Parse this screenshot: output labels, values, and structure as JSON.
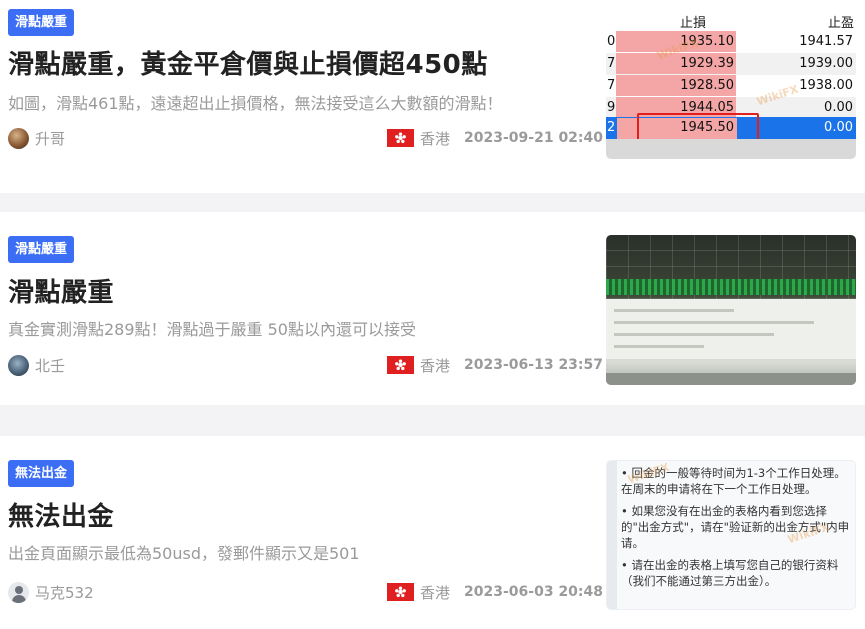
{
  "articles": [
    {
      "tag": "滑點嚴重",
      "title": "滑點嚴重，黃金平倉價與止損價超450點",
      "summary": "如圖，滑點461點，遠遠超出止損價格，無法接受這么大數額的滑點！",
      "author": "升哥",
      "region": "香港",
      "time": "2023-09-21 02:40",
      "thumb": {
        "headers": [
          "止損",
          "止盈"
        ],
        "rows": [
          {
            "idx": "0",
            "sl": "1935.10",
            "tp": "1941.57"
          },
          {
            "idx": "7",
            "sl": "1929.39",
            "tp": "1939.00"
          },
          {
            "idx": "7",
            "sl": "1928.50",
            "tp": "1938.00"
          },
          {
            "idx": "9",
            "sl": "1944.05",
            "tp": "0.00"
          },
          {
            "idx": "2",
            "sl": "1945.50",
            "tp": "0.00"
          }
        ]
      }
    },
    {
      "tag": "滑點嚴重",
      "title": "滑點嚴重",
      "summary": "真金實測滑點289點！滑點過于嚴重 50點以內還可以接受",
      "author": "北壬",
      "region": "香港",
      "time": "2023-06-13 23:57"
    },
    {
      "tag": "無法出金",
      "title": "無法出金",
      "summary": "出金頁面顯示最低為50usd，發郵件顯示又是501",
      "author": "马克532",
      "region": "香港",
      "time": "2023-06-03 20:48",
      "thumb": {
        "lines": [
          "• 回金的一般等待时间为1-3个工作日处理。在周末的申请将在下一个工作日处理。",
          "• 如果您没有在出金的表格内看到您选择的\"出金方式\"，请在\"验证新的出金方式\"内申请。",
          "• 请在出金的表格上填写您自己的银行资料（我们不能通过第三方出金）。"
        ]
      }
    }
  ],
  "watermark": "WikiFX",
  "colors": {
    "tag": "#3b6ef5",
    "flag": "#e02020",
    "highlight": "#1a73e8"
  }
}
